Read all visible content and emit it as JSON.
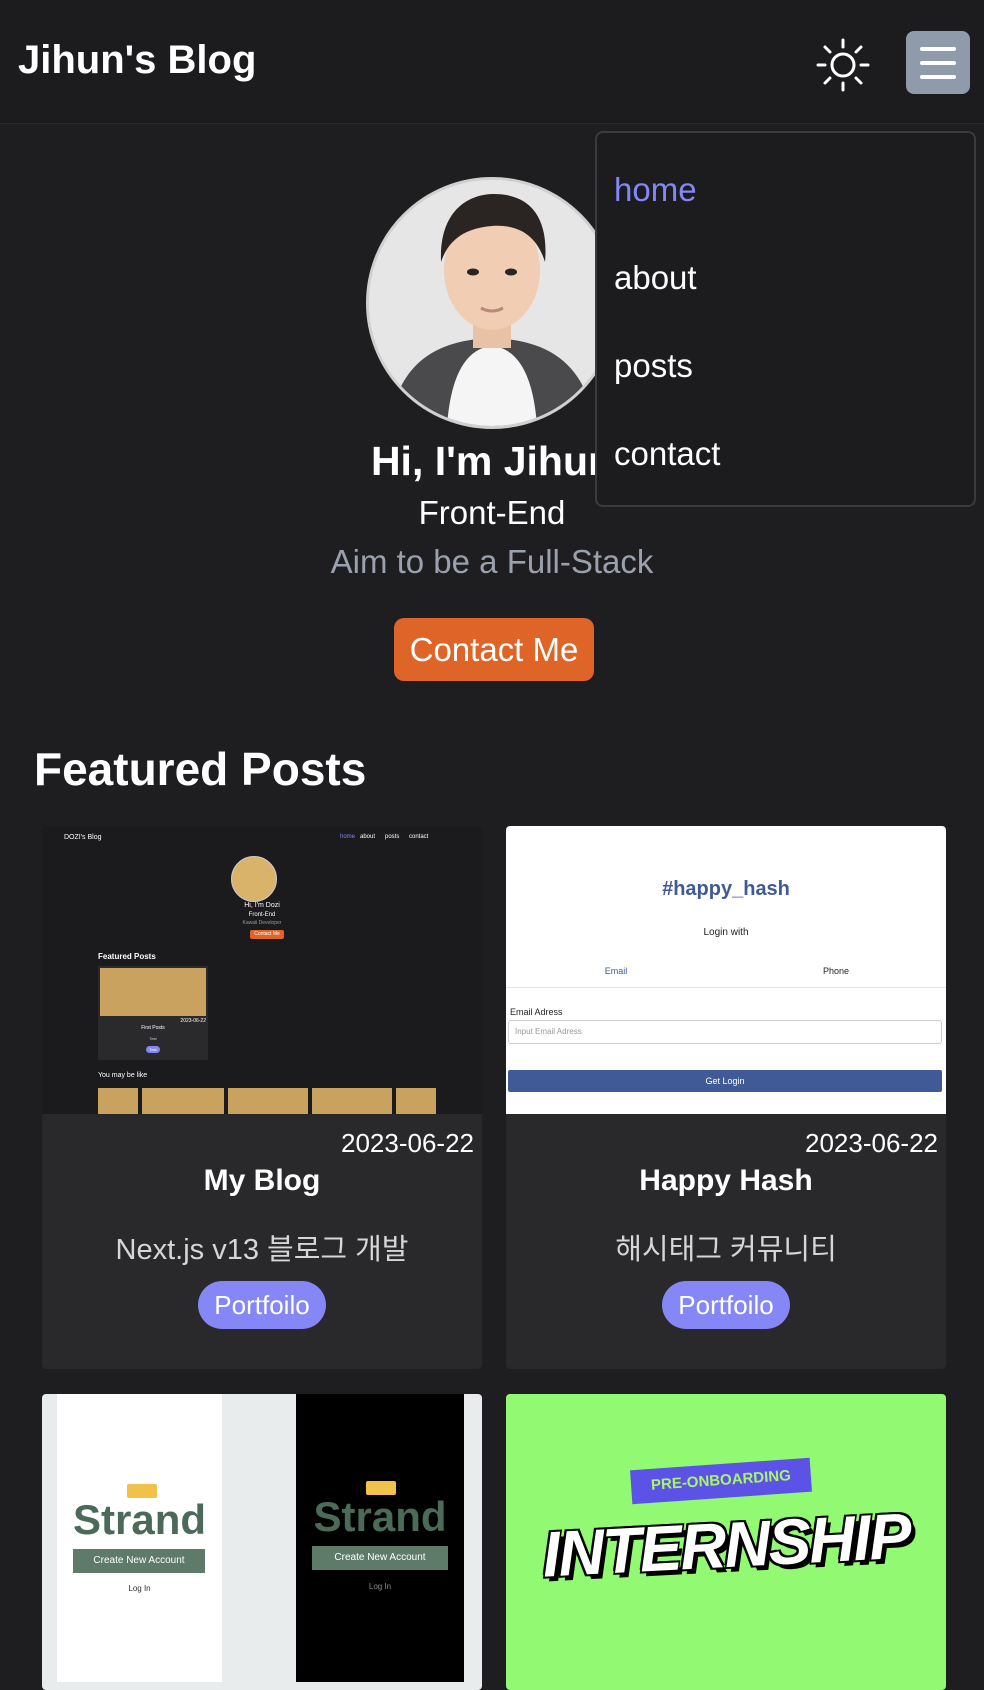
{
  "header": {
    "brand": "Jihun's Blog",
    "theme_icon": "sun-icon",
    "menu_icon": "hamburger-menu-icon"
  },
  "menu": {
    "items": [
      {
        "label": "home",
        "active": true
      },
      {
        "label": "about",
        "active": false
      },
      {
        "label": "posts",
        "active": false
      },
      {
        "label": "contact",
        "active": false
      }
    ]
  },
  "hero": {
    "greeting": "Hi, I'm Jihun",
    "role": "Front-End",
    "aim": "Aim to be a Full-Stack",
    "contact_label": "Contact Me"
  },
  "featured": {
    "title": "Featured Posts",
    "posts": [
      {
        "date": "2023-06-22",
        "title": "My Blog",
        "description": "Next.js v13 블로그 개발",
        "category": "Portfoilo"
      },
      {
        "date": "2023-06-22",
        "title": "Happy Hash",
        "description": "해시태그 커뮤니티",
        "category": "Portfoilo"
      }
    ]
  },
  "thumb_blog": {
    "brand": "DOZI's Blog",
    "nav": [
      "home",
      "about",
      "posts",
      "contact"
    ],
    "greeting": "Hi, I'm Dozi",
    "role": "Front-End",
    "aim": "Kawaii Developer",
    "contact": "Contact Me",
    "featured": "Featured Posts",
    "post_title": "First Posts",
    "post_desc": "Test",
    "post_date": "2023-06-22",
    "post_tag": "Test",
    "like": "You may be like"
  },
  "thumb_hash": {
    "logo": "#happy_hash",
    "login_with": "Login with",
    "tab_email": "Email",
    "tab_phone": "Phone",
    "email_label": "Email Adress",
    "email_placeholder": "Input Email Adress",
    "submit": "Get Login"
  },
  "thumb_strand": {
    "logo": "Strand",
    "create": "Create New Account",
    "login": "Log In"
  },
  "thumb_intern": {
    "banner": "PRE-ONBOARDING",
    "title": "INTERNSHIP"
  },
  "colors": {
    "accent": "#8487f5",
    "cta": "#de6428",
    "background": "#1e1e21"
  }
}
